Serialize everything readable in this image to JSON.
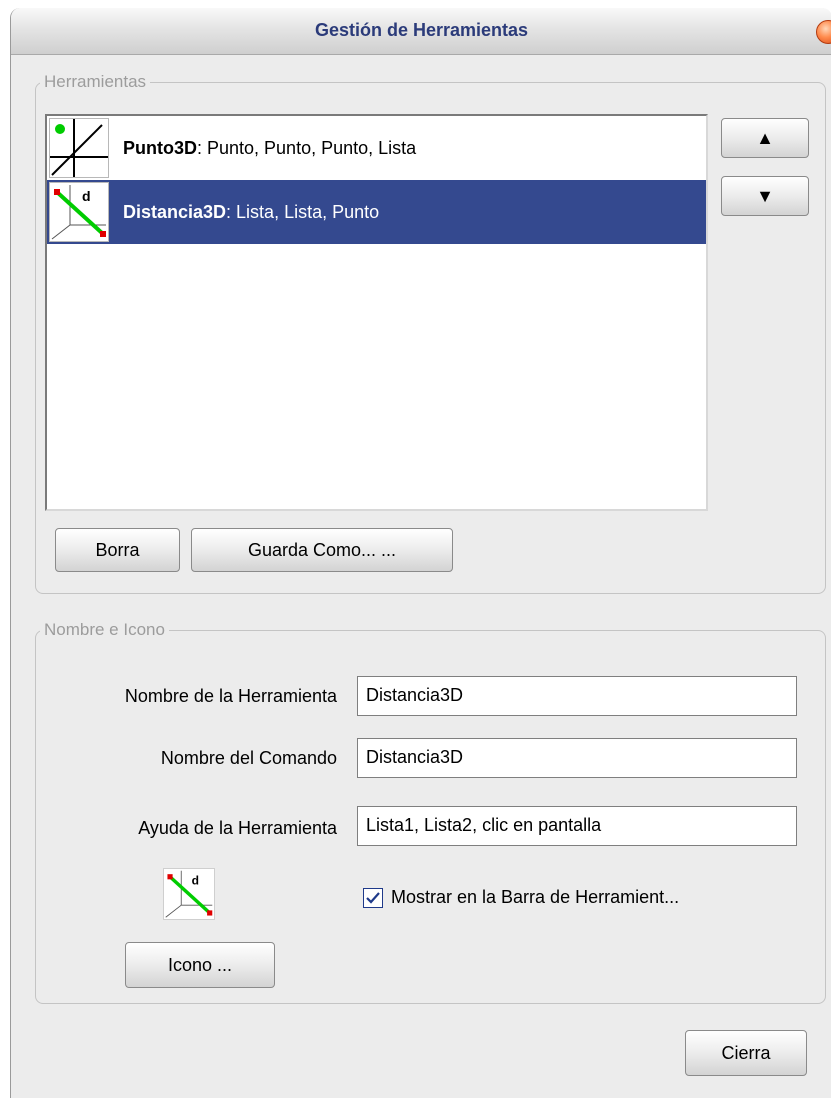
{
  "window": {
    "title": "Gestión de Herramientas"
  },
  "tools_group": {
    "legend": "Herramientas",
    "items": [
      {
        "name": "Punto3D",
        "args": ": Punto, Punto, Punto, Lista",
        "icon": "punto3d-icon",
        "selected": false
      },
      {
        "name": "Distancia3D",
        "args": ": Lista, Lista, Punto",
        "icon": "distancia3d-icon",
        "selected": true
      }
    ],
    "move_up_label": "▲",
    "move_down_label": "▼",
    "delete_label": "Borra",
    "save_as_label": "Guarda Como... ..."
  },
  "name_icon_group": {
    "legend": "Nombre e Icono",
    "tool_name_label": "Nombre de la Herramienta",
    "tool_name_value": "Distancia3D",
    "command_name_label": "Nombre del Comando",
    "command_name_value": "Distancia3D",
    "tool_help_label": "Ayuda de la Herramienta",
    "tool_help_value": "Lista1, Lista2, clic en pantalla",
    "icon_button_label": "Icono ...",
    "show_toolbar_label": "Mostrar en la Barra de Herramient...",
    "show_toolbar_checked": true
  },
  "close_label": "Cierra",
  "colors": {
    "selection": "#34498f",
    "title_text": "#2b3b7a",
    "line_green": "#00cc00",
    "point_red": "#e00000"
  }
}
